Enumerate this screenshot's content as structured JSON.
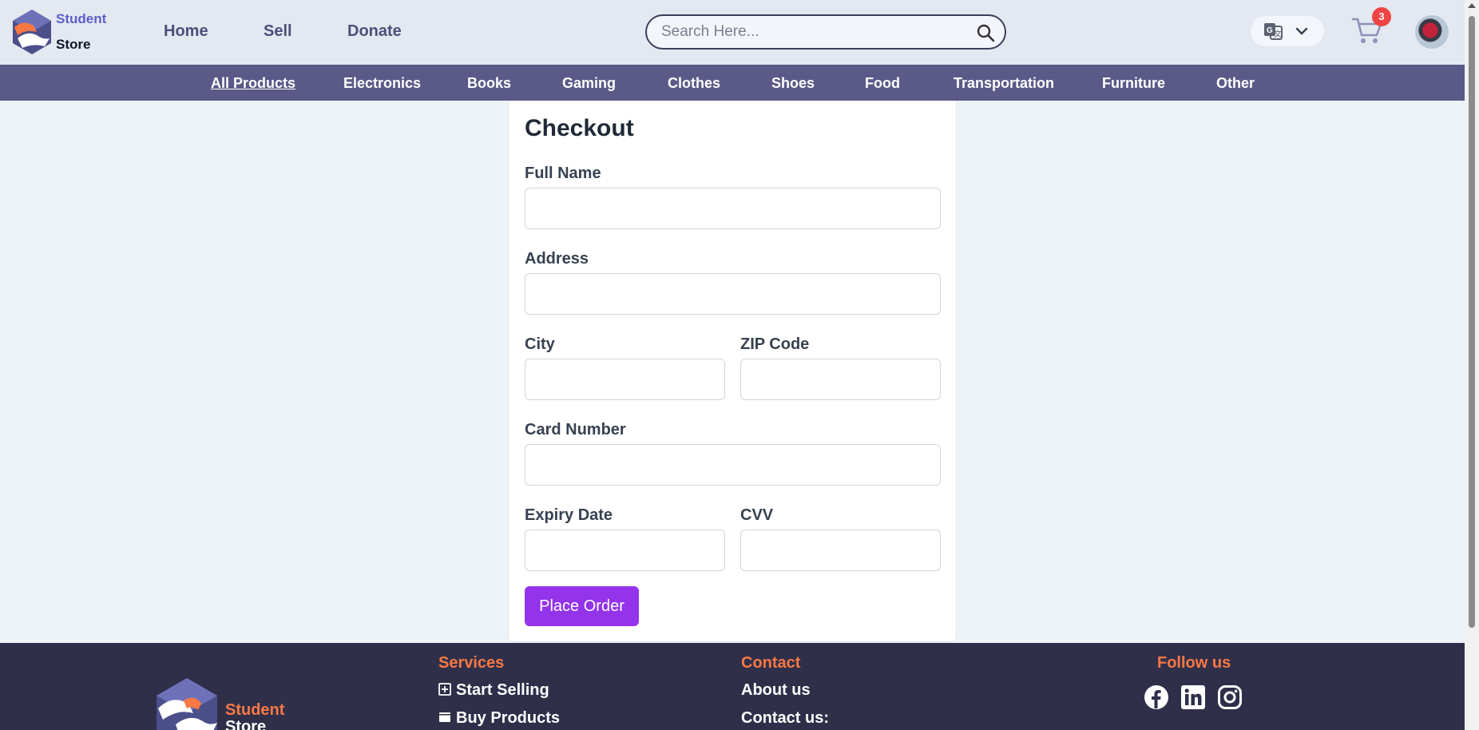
{
  "brand": {
    "name_line1": "Student",
    "name_line2": "Store"
  },
  "nav": {
    "home": "Home",
    "sell": "Sell",
    "donate": "Donate"
  },
  "search": {
    "placeholder": "Search Here..."
  },
  "cart": {
    "count": "3"
  },
  "categories": [
    "All Products",
    "Electronics",
    "Books",
    "Gaming",
    "Clothes",
    "Shoes",
    "Food",
    "Transportation",
    "Furniture",
    "Other"
  ],
  "checkout": {
    "title": "Checkout",
    "full_name_label": "Full Name",
    "address_label": "Address",
    "city_label": "City",
    "zip_label": "ZIP Code",
    "card_label": "Card Number",
    "expiry_label": "Expiry Date",
    "cvv_label": "CVV",
    "submit_label": "Place Order"
  },
  "footer": {
    "services_heading": "Services",
    "services": [
      "Start Selling",
      "Buy Products"
    ],
    "contact_heading": "Contact",
    "contact": [
      "About us",
      "Contact us:"
    ],
    "follow_heading": "Follow us",
    "social_icons": [
      "facebook-icon",
      "linkedin-icon",
      "instagram-icon"
    ]
  },
  "colors": {
    "accent": "#9333ea",
    "nav_bar": "#5a5987",
    "footer_bg": "#2f2f4a",
    "footer_heading": "#f97843"
  }
}
